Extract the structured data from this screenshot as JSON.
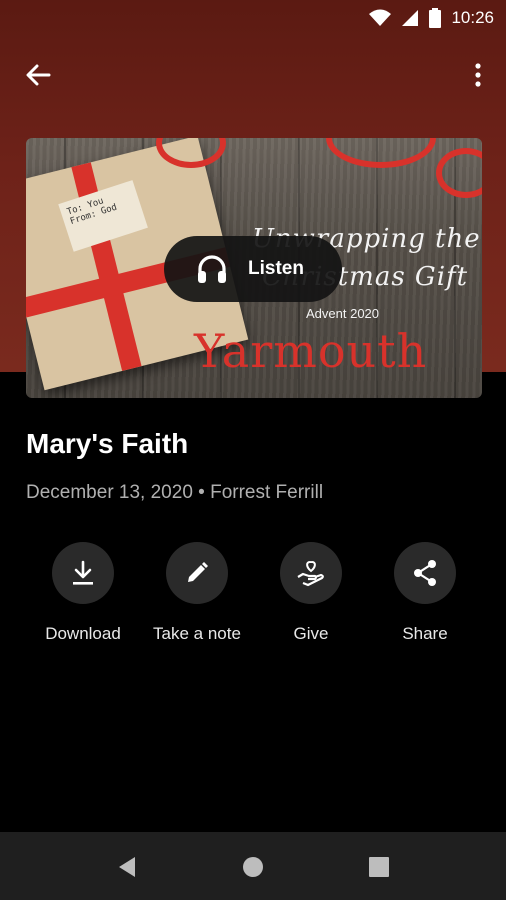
{
  "status_bar": {
    "time": "10:26",
    "icons": [
      "wifi-icon",
      "signal-icon",
      "battery-icon"
    ]
  },
  "app_bar": {
    "back_icon": "arrow-back-icon",
    "menu_icon": "more-vert-icon"
  },
  "artwork": {
    "tag_text": "To: You From: God",
    "title_line1": "Unwrapping the",
    "title_line2": "Christmas Gift",
    "subtitle": "Advent 2020",
    "location": "Yarmouth"
  },
  "listen_button": {
    "icon": "headphones-icon",
    "label": "Listen"
  },
  "sermon": {
    "title": "Mary's Faith",
    "date": "December 13, 2020",
    "separator": "•",
    "speaker": "Forrest Ferrill"
  },
  "actions": [
    {
      "label": "Download",
      "icon": "download-icon"
    },
    {
      "label": "Take a note",
      "icon": "pencil-icon"
    },
    {
      "label": "Give",
      "icon": "give-heart-hand-icon"
    },
    {
      "label": "Share",
      "icon": "share-icon"
    }
  ],
  "nav_bar": {
    "icons": [
      "nav-back-icon",
      "nav-home-icon",
      "nav-recents-icon"
    ]
  },
  "colors": {
    "header": "#6e2219",
    "background": "#000000",
    "accent_red": "#d8322b",
    "action_circle": "#2a2a2a",
    "meta_text": "#b0b0b0"
  }
}
